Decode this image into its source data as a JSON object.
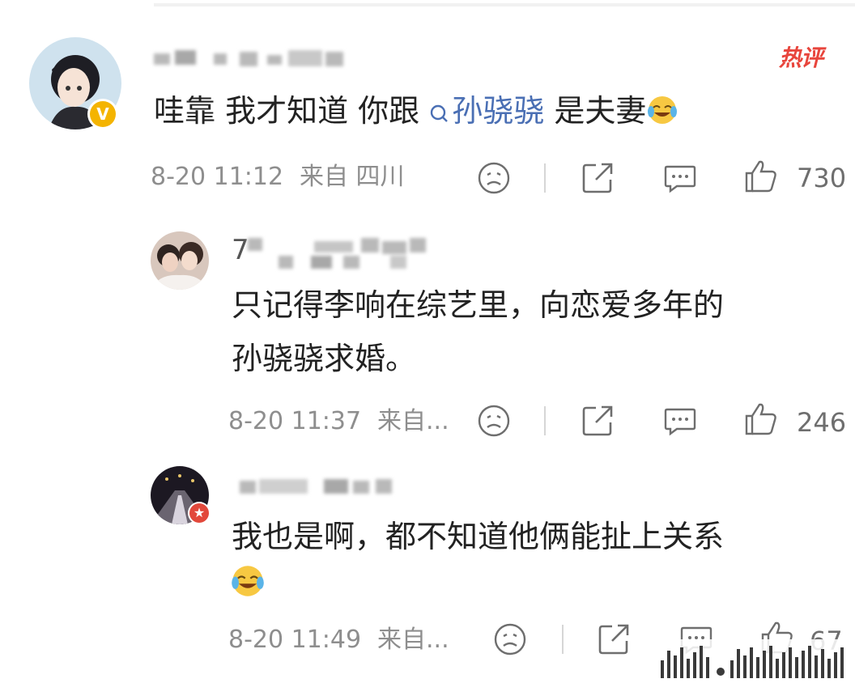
{
  "badge": {
    "hot_label": "热评"
  },
  "comment": {
    "text_before": "哇靠 我才知道 你跟",
    "topic": "孙骁骁",
    "text_after": "是夫妻",
    "time": "8-20 11:12",
    "location": "来自 四川",
    "likes": "730"
  },
  "replies": [
    {
      "name_prefix": "7",
      "line1": "只记得李响在综艺里，向恋爱多年的",
      "line2": "孙骁骁求婚。",
      "time": "8-20 11:37",
      "location": "来自...",
      "likes": "246"
    },
    {
      "line1": "我也是啊，都不知道他俩能扯上关系",
      "time": "8-20 11:49",
      "location": "来自...",
      "likes": "67"
    }
  ],
  "icons": {
    "dislike": "frown-face-icon",
    "share": "share-icon",
    "comment": "comment-bubble-icon",
    "like": "thumbs-up-icon",
    "emoji": "laugh-cry-emoji"
  },
  "colors": {
    "hot": "#e8453c",
    "topic": "#4a6fb4",
    "meta": "#8e8e8e"
  }
}
